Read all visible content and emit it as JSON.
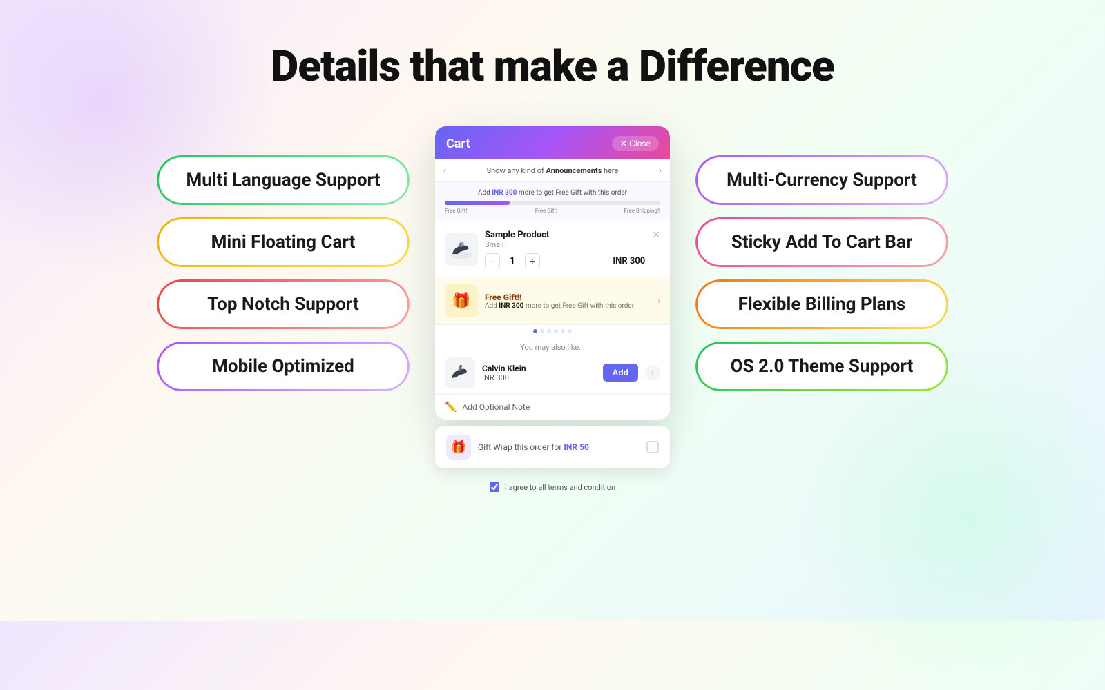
{
  "page": {
    "title": "Details that make a Difference"
  },
  "features_left": [
    {
      "id": "multi-language",
      "label": "Multi Language Support",
      "color": "pill-green"
    },
    {
      "id": "mini-floating-cart",
      "label": "Mini Floating Cart",
      "color": "pill-yellow"
    },
    {
      "id": "top-notch-support",
      "label": "Top Notch Support",
      "color": "pill-red"
    },
    {
      "id": "mobile-optimized",
      "label": "Mobile Optimized",
      "color": "pill-purple"
    }
  ],
  "features_right": [
    {
      "id": "multi-currency",
      "label": "Multi-Currency Support",
      "color": "pill-purple"
    },
    {
      "id": "sticky-add-to-cart",
      "label": "Sticky Add To Cart Bar",
      "color": "pill-pink"
    },
    {
      "id": "flexible-billing",
      "label": "Flexible Billing Plans",
      "color": "pill-orange"
    },
    {
      "id": "os-theme-support",
      "label": "OS 2.0 Theme Support",
      "color": "pill-green-right"
    }
  ],
  "cart": {
    "title": "Cart",
    "close_label": "✕ Close",
    "announcement_prev": "‹",
    "announcement_next": "›",
    "announcement_text": "Show any kind of ",
    "announcement_bold": "Announcements",
    "announcement_suffix": " here",
    "progress_text_prefix": "Add ",
    "progress_amount": "INR 300",
    "progress_text_suffix": " more to get Free Gift with this order",
    "progress_milestone_1": "Free Gift!!",
    "progress_milestone_2": "Free Gift!",
    "progress_milestone_3": "Free Shipping!!",
    "product_name": "Sample Product",
    "product_variant": "Small",
    "qty_minus": "-",
    "qty_value": "1",
    "qty_plus": "+",
    "product_price": "INR 300",
    "free_gift_title": "Free Gift!!",
    "free_gift_desc_prefix": "Add ",
    "free_gift_desc_amount": "INR 300",
    "free_gift_desc_suffix": " more to get Free Gift with this order",
    "upsell_heading": "You may also like...",
    "upsell_name": "Calvin Klein",
    "upsell_price": "INR 300",
    "upsell_add_btn": "Add",
    "add_note_text": "Add Optional Note",
    "gift_wrap_text_prefix": "Gift Wrap this order for ",
    "gift_wrap_amount": "INR 50",
    "terms_text": "I agree to all terms and condition"
  }
}
